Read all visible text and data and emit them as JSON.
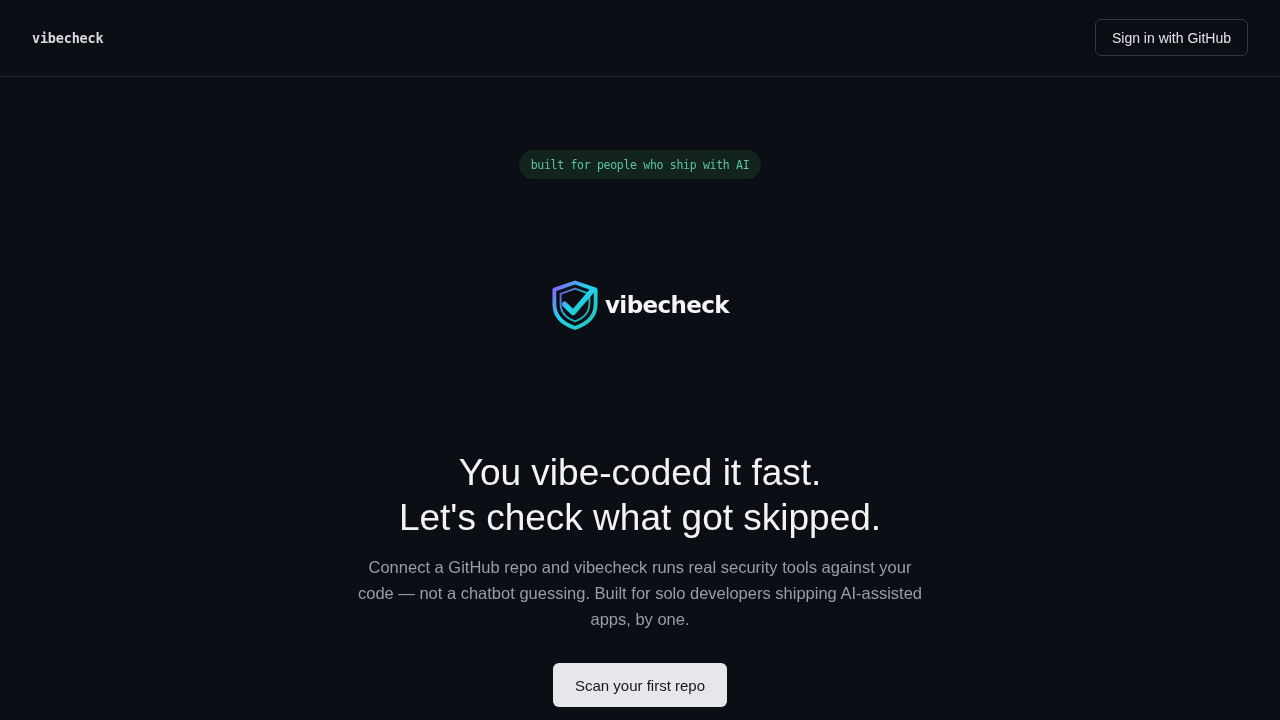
{
  "header": {
    "brand": "vibecheck",
    "sign_in_button": "Sign in with GitHub"
  },
  "hero": {
    "badge": "built for people who ship with AI",
    "logo_text": "vibecheck",
    "headline": [
      "You vibe-coded it fast.",
      "Let's check what got skipped."
    ],
    "description": "Connect a GitHub repo and vibecheck runs real security tools against your code — not a chatbot guessing. Built for solo developers shipping AI-assisted apps, by one.",
    "cta_button": "Scan your first repo"
  }
}
